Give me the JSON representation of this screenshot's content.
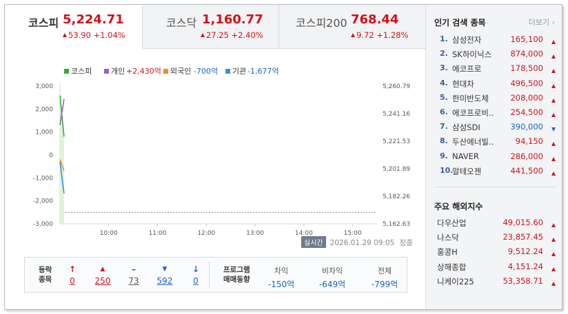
{
  "tabs": [
    {
      "name": "코스피",
      "value": "5,224.71",
      "change": "53.90 +1.04%",
      "active": true
    },
    {
      "name": "코스닥",
      "value": "1,160.77",
      "change": "27.25 +2.40%",
      "active": false
    },
    {
      "name": "코스피200",
      "value": "768.44",
      "change": "9.72 +1.28%",
      "active": false
    }
  ],
  "legend": {
    "index": "코스피",
    "individual_label": "개인",
    "individual_value": "+2,430억",
    "foreign_label": "외국인",
    "foreign_value": "-700억",
    "institution_label": "기관",
    "institution_value": "-1,677억"
  },
  "colors": {
    "up": "#d2121b",
    "down": "#1a63c8",
    "kospi": "#3aa83a",
    "individual": "#a25ad0",
    "foreign": "#f08c22",
    "institution": "#2f94e0"
  },
  "chart_data": {
    "type": "line",
    "x_ticks": [
      "10:00",
      "11:00",
      "12:00",
      "13:00",
      "14:00",
      "15:00"
    ],
    "y_left": {
      "ticks": [
        "3,000",
        "2,000",
        "1,000",
        "0",
        "-1,000",
        "-2,000",
        "-3,000"
      ],
      "range": [
        -3000,
        3000
      ]
    },
    "y_right": {
      "ticks": [
        "5,260.79",
        "5,241.16",
        "5,221.53",
        "5,201.89",
        "5,182.26",
        "5,162.63"
      ],
      "range": [
        5162.63,
        5260.79
      ]
    },
    "time_range": [
      "09:00",
      "15:30"
    ],
    "series": [
      {
        "name": "코스피",
        "axis": "right",
        "x": [
          "09:00",
          "09:05"
        ],
        "values": [
          5254,
          5224.71
        ]
      },
      {
        "name": "개인",
        "axis": "left",
        "x": [
          "09:00",
          "09:05"
        ],
        "values": [
          1300,
          2430
        ]
      },
      {
        "name": "외국인",
        "axis": "left",
        "x": [
          "09:00",
          "09:05"
        ],
        "values": [
          -200,
          -700
        ]
      },
      {
        "name": "기관",
        "axis": "left",
        "x": [
          "09:00",
          "09:05"
        ],
        "values": [
          -300,
          -1677
        ]
      }
    ],
    "reference_level": -2500
  },
  "status": {
    "badge": "실시간",
    "datetime": "2026.01.29 09:05",
    "state": "장중"
  },
  "breadth": {
    "label_top": "등락",
    "label_bottom": "종목",
    "items": [
      {
        "icon": "↑",
        "value": "0",
        "kind": "upper-limit"
      },
      {
        "icon": "▲",
        "value": "250",
        "kind": "up"
      },
      {
        "icon": "–",
        "value": "73",
        "kind": "flat"
      },
      {
        "icon": "▼",
        "value": "592",
        "kind": "down"
      },
      {
        "icon": "↓",
        "value": "0",
        "kind": "lower-limit"
      }
    ]
  },
  "program": {
    "label_top": "프로그램",
    "label_bottom": "매매동향",
    "items": [
      {
        "header": "차익",
        "value": "-150억"
      },
      {
        "header": "비차익",
        "value": "-649억"
      },
      {
        "header": "전체",
        "value": "-799억"
      }
    ]
  },
  "popular": {
    "title": "인기 검색 종목",
    "more": "더보기",
    "items": [
      {
        "rank": "1.",
        "name": "삼성전자",
        "price": "165,100",
        "dir": "up"
      },
      {
        "rank": "2.",
        "name": "SK하이닉스",
        "price": "874,000",
        "dir": "up"
      },
      {
        "rank": "3.",
        "name": "에코프로",
        "price": "178,500",
        "dir": "up"
      },
      {
        "rank": "4.",
        "name": "현대차",
        "price": "496,500",
        "dir": "up"
      },
      {
        "rank": "5.",
        "name": "한미반도체",
        "price": "208,000",
        "dir": "up"
      },
      {
        "rank": "6.",
        "name": "에코프로비..",
        "price": "254,500",
        "dir": "up"
      },
      {
        "rank": "7.",
        "name": "삼성SDI",
        "price": "390,000",
        "dir": "down"
      },
      {
        "rank": "8.",
        "name": "두산에너빌..",
        "price": "94,150",
        "dir": "up"
      },
      {
        "rank": "9.",
        "name": "NAVER",
        "price": "286,000",
        "dir": "up"
      },
      {
        "rank": "10.",
        "name": "알테오젠",
        "price": "441,500",
        "dir": "up"
      }
    ]
  },
  "overseas": {
    "title": "주요 해외지수",
    "items": [
      {
        "name": "다우산업",
        "value": "49,015.60",
        "dir": "up"
      },
      {
        "name": "나스닥",
        "value": "23,857.45",
        "dir": "up"
      },
      {
        "name": "홍콩H",
        "value": "9,512.24",
        "dir": "up"
      },
      {
        "name": "상해종합",
        "value": "4,151.24",
        "dir": "up"
      },
      {
        "name": "니케이225",
        "value": "53,358.71",
        "dir": "up"
      }
    ]
  }
}
